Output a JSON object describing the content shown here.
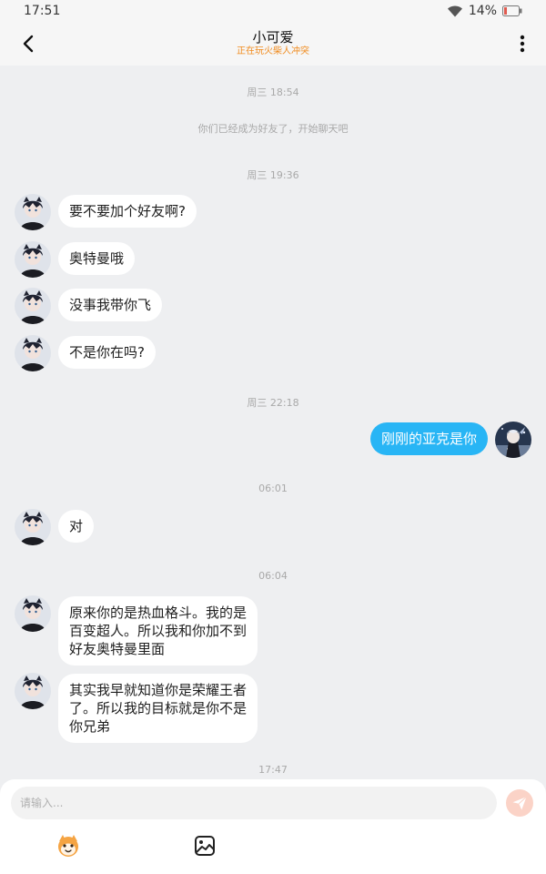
{
  "status_bar": {
    "time": "17:51",
    "battery": "14%",
    "icons": [
      "wifi-icon",
      "battery-icon"
    ]
  },
  "header": {
    "title": "小可爱",
    "subtitle": "正在玩火柴人冲突",
    "back_icon": "chevron-left-icon",
    "more_icon": "more-vertical-icon",
    "subtitle_color": "#f08a1c"
  },
  "chat": {
    "timestamps": [
      "周三 18:54",
      "周三 19:36",
      "周三 22:18",
      "06:01",
      "06:04",
      "17:47"
    ],
    "system_message": "你们已经成为好友了，开始聊天吧",
    "messages": [
      {
        "sender": "friend",
        "text": "要不要加个好友啊?"
      },
      {
        "sender": "friend",
        "text": "奥特曼哦"
      },
      {
        "sender": "friend",
        "text": "没事我带你飞"
      },
      {
        "sender": "friend",
        "text": "不是你在吗?"
      },
      {
        "sender": "me",
        "text": "刚刚的亚克是你"
      },
      {
        "sender": "friend",
        "text": "对"
      },
      {
        "sender": "friend",
        "text": "原来你的是热血格斗。我的是\n百变超人。所以我和你加不到\n好友奥特曼里面"
      },
      {
        "sender": "friend",
        "text": "其实我早就知道你是荣耀王者\n了。所以我的目标就是你不是\n你兄弟"
      }
    ],
    "my_bubble_color": "#28b5f5",
    "friend_bubble_color": "#ffffff"
  },
  "input": {
    "placeholder": "请输入...",
    "value": "",
    "send_icon": "send-icon",
    "tools": [
      "emoji-mascot-icon",
      "image-icon"
    ]
  }
}
